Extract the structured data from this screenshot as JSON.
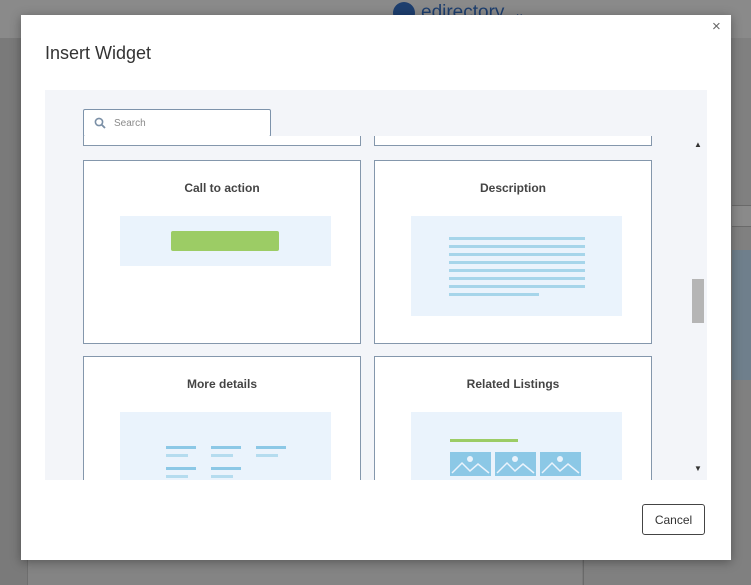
{
  "background": {
    "brand_name": "edirectory"
  },
  "modal": {
    "title": "Insert Widget",
    "close_symbol": "×",
    "search": {
      "placeholder": "Search",
      "value": ""
    },
    "widgets": [
      {
        "title": "Call to action",
        "icon": "call-to-action-preview"
      },
      {
        "title": "Description",
        "icon": "description-preview"
      },
      {
        "title": "More details",
        "icon": "more-details-preview"
      },
      {
        "title": "Related Listings",
        "icon": "related-listings-preview"
      }
    ],
    "cancel_label": "Cancel",
    "colors": {
      "button_green": "#9ccc65",
      "line_blue": "#a6d5ea",
      "image_blue": "#8cc8e6",
      "preview_bg": "#eaf3fc"
    }
  }
}
